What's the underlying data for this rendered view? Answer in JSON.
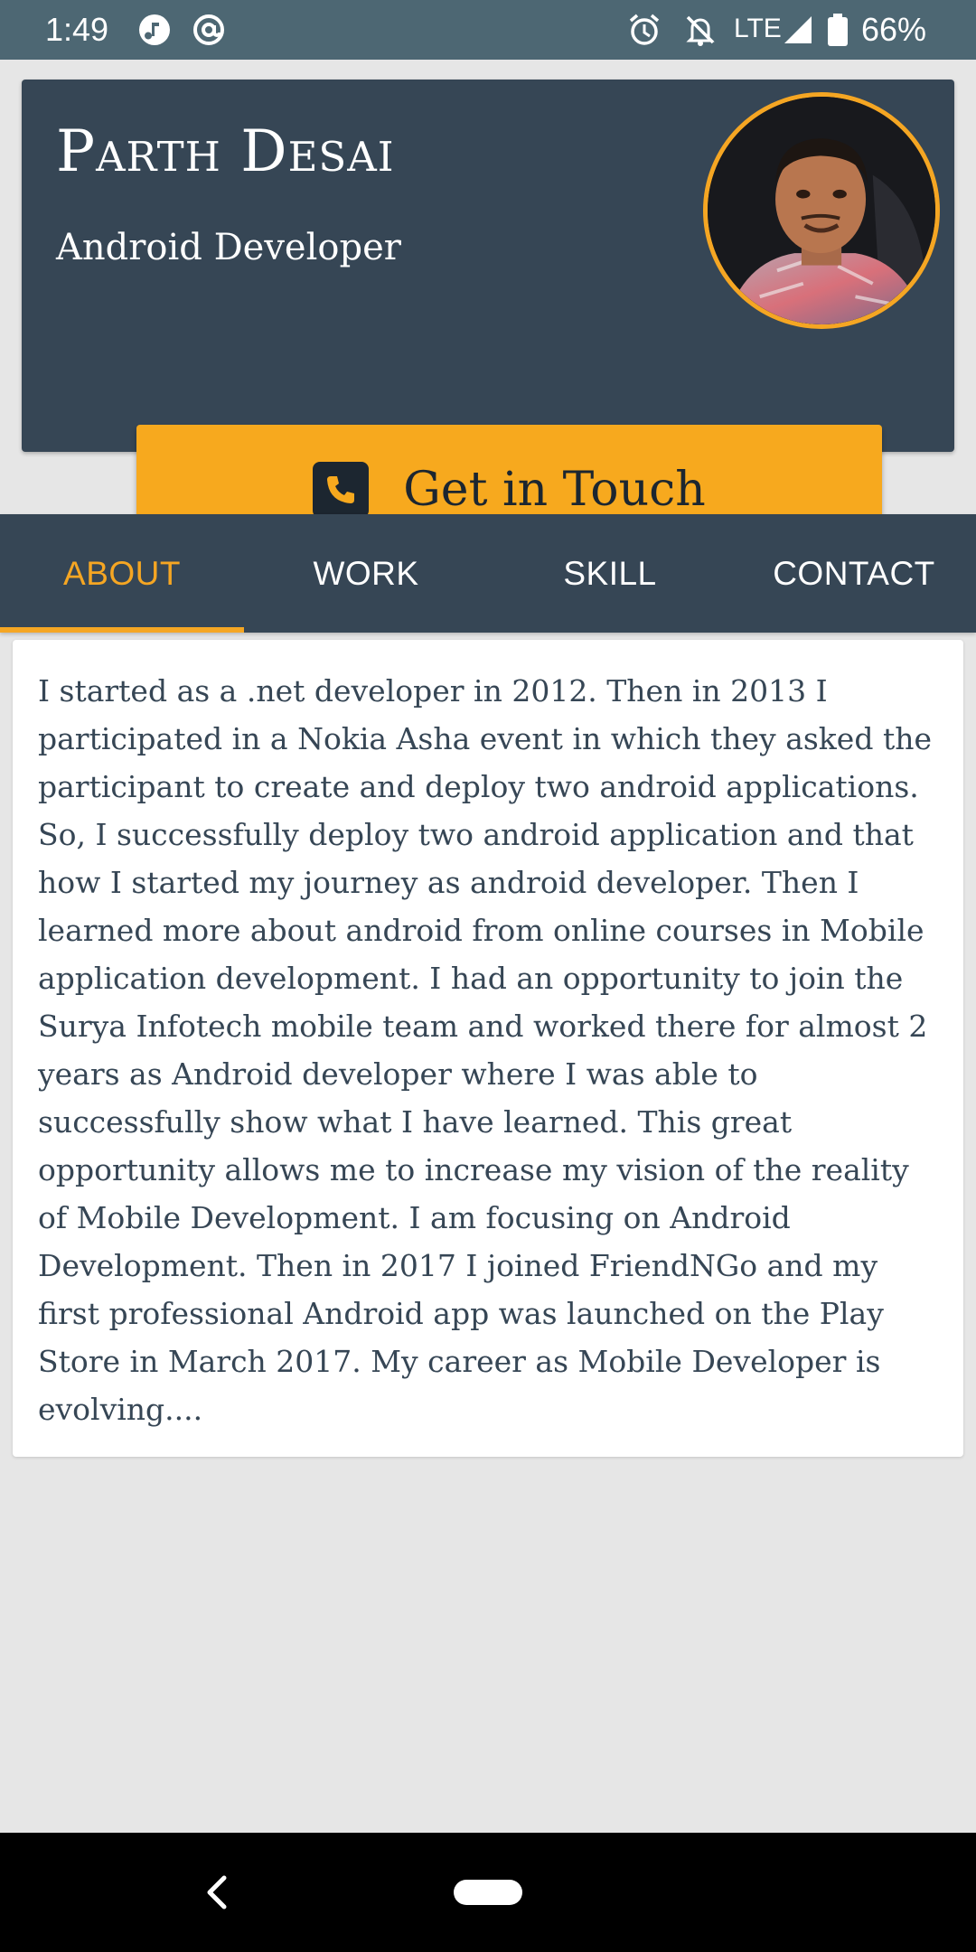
{
  "status_bar": {
    "time": "1:49",
    "network": "LTE",
    "battery": "66%",
    "icons": [
      "music-note-icon",
      "at-sign-icon",
      "alarm-icon",
      "notifications-off-icon",
      "signal-icon",
      "battery-icon"
    ]
  },
  "profile": {
    "name": "Parth Desai",
    "role": "Android Developer",
    "avatar": "profile-photo",
    "cta_label": "Get in Touch",
    "cta_icon": "phone-icon"
  },
  "tabs": [
    {
      "label": "ABOUT",
      "active": true
    },
    {
      "label": "WORK",
      "active": false
    },
    {
      "label": "SKILL",
      "active": false
    },
    {
      "label": "CONTACT",
      "active": false
    }
  ],
  "about": {
    "text": "I started as a .net developer in 2012. Then in 2013 I participated in a Nokia Asha event in which they asked the participant to create and deploy two android applications. So, I successfully deploy two android application and that how I started my journey as android developer. Then I learned more about android from online courses in Mobile application development. I had an opportunity to join the Surya Infotech mobile team and worked there for almost 2 years as Android developer where I was able to successfully show what I have learned. This great opportunity allows me to increase my vision of the reality of Mobile Development. I am focusing on Android Development. Then in 2017 I joined FriendNGo and my first professional Android app was launched on the Play Store in March 2017. My career as Mobile Developer is evolving...."
  },
  "nav": {
    "back_icon": "back-chevron-icon",
    "home_icon": "home-pill-icon"
  },
  "colors": {
    "primary_dark": "#364655",
    "accent": "#f5a623",
    "button": "#f7a91e",
    "status_bar": "#4d6773",
    "background": "#e6e6e6"
  }
}
